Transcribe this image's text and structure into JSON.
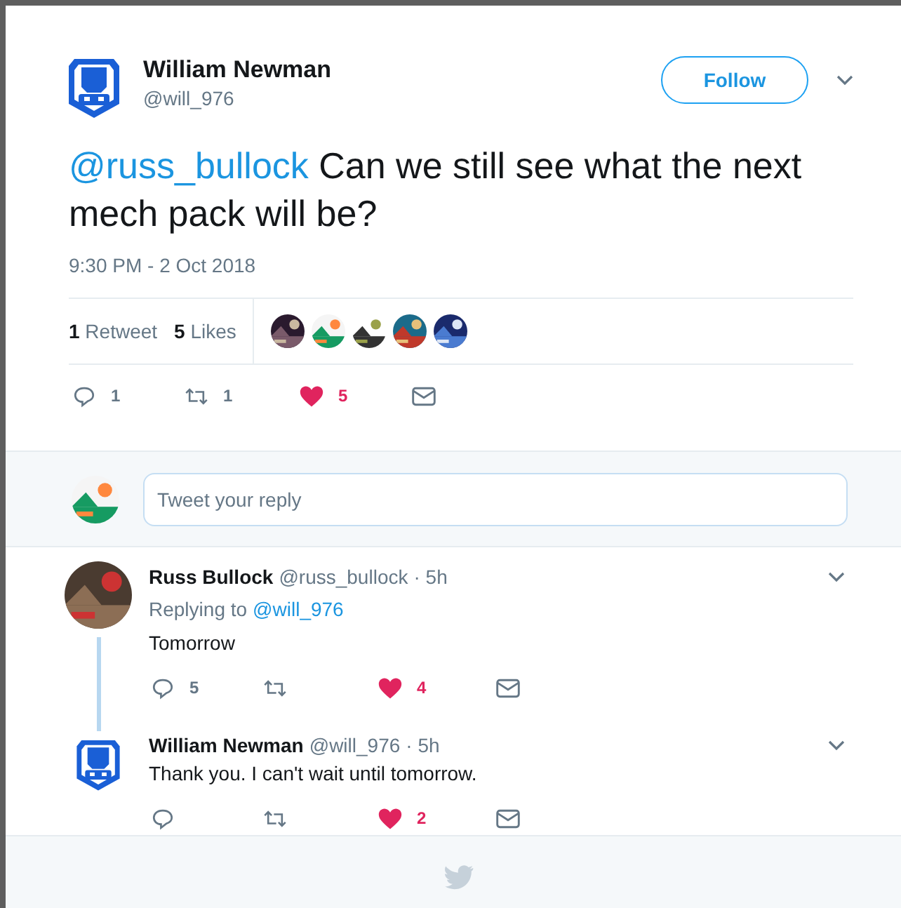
{
  "tweet": {
    "author": {
      "name": "William Newman",
      "handle": "@will_976"
    },
    "follow_button": "Follow",
    "mention": "@russ_bullock",
    "text": "Can we still see what the next mech pack will be?",
    "timestamp": "9:30 PM - 2 Oct 2018",
    "stats": [
      {
        "count": "1",
        "label": "Retweet"
      },
      {
        "count": "5",
        "label": "Likes"
      }
    ],
    "actions": {
      "replies": "1",
      "retweets": "1",
      "likes": "5",
      "liked": true
    }
  },
  "reply_box": {
    "placeholder": "Tweet your reply"
  },
  "replies": [
    {
      "name": "Russ Bullock",
      "handle": "@russ_bullock",
      "time": "· 5h",
      "replying_prefix": "Replying to",
      "replying_to": "@will_976",
      "text": "Tomorrow",
      "actions": {
        "replies": "5",
        "likes": "4",
        "liked": true
      },
      "thread_line": true
    },
    {
      "name": "William Newman",
      "handle": "@will_976",
      "time": "· 5h",
      "avatar": {
        "kind": "logo"
      },
      "text": "Thank you. I can't wait until tomorrow.",
      "actions": {
        "likes": "2",
        "liked": true
      },
      "thread_line": false
    }
  ]
}
